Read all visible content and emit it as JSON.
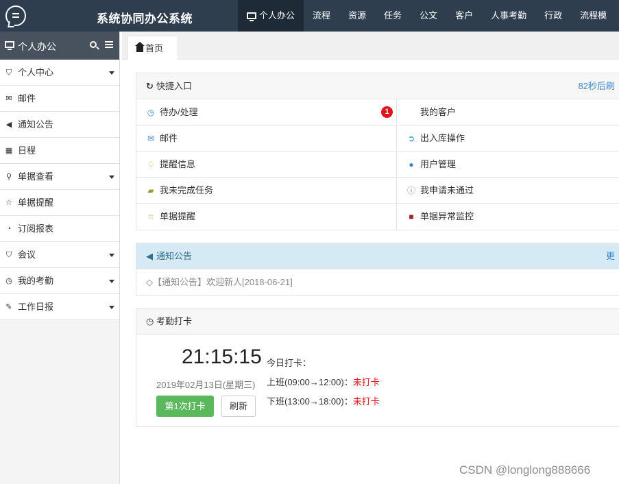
{
  "app": {
    "title": "系统协同办公系统"
  },
  "topnav": [
    {
      "label": "个人办公",
      "active": true
    },
    {
      "label": "流程"
    },
    {
      "label": "资源"
    },
    {
      "label": "任务"
    },
    {
      "label": "公文"
    },
    {
      "label": "客户"
    },
    {
      "label": "人事考勤"
    },
    {
      "label": "行政"
    },
    {
      "label": "流程模"
    }
  ],
  "sidebar": {
    "title": "个人办公",
    "items": [
      {
        "label": "个人中心",
        "icon": "bookmark-icon",
        "caret": true
      },
      {
        "label": "邮件",
        "icon": "envelope-icon"
      },
      {
        "label": "通知公告",
        "icon": "volume-icon"
      },
      {
        "label": "日程",
        "icon": "calendar-icon"
      },
      {
        "label": "单据查看",
        "icon": "search-icon",
        "caret": true
      },
      {
        "label": "单据提醒",
        "icon": "star-icon"
      },
      {
        "label": "订阅报表",
        "icon": "rss-icon"
      },
      {
        "label": "会议",
        "icon": "bookmark-icon",
        "caret": true
      },
      {
        "label": "我的考勤",
        "icon": "clock-icon",
        "caret": true
      },
      {
        "label": "工作日报",
        "icon": "edit-icon",
        "caret": true
      }
    ]
  },
  "tabs": [
    {
      "label": "首页"
    }
  ],
  "quick": {
    "title": "快捷入口",
    "refresh_text": "82秒后刷",
    "rows": [
      {
        "left": "待办/处理",
        "left_badge": "1",
        "right": "我的客户"
      },
      {
        "left": "邮件",
        "right": "出入库操作"
      },
      {
        "left": "提醒信息",
        "right": "用户管理"
      },
      {
        "left": "我未完成任务",
        "right": "我申请未通过"
      },
      {
        "left": "单据提醒",
        "right": "单据异常监控"
      }
    ]
  },
  "notice": {
    "title": "通知公告",
    "more": "更",
    "items": [
      "◇【通知公告】欢迎新人[2018-06-21]"
    ]
  },
  "attendance": {
    "title": "考勤打卡",
    "time": "21:15:15",
    "date": "2019年02月13日(星期三)",
    "punch_button": "第1次打卡",
    "refresh_button": "刷新",
    "today_label": "今日打卡：",
    "shifts": [
      {
        "label": "上班(09:00→12:00)：",
        "status": "未打卡"
      },
      {
        "label": "下班(13:00→18:00)：",
        "status": "未打卡"
      }
    ]
  },
  "watermark": "CSDN @longlong888666"
}
